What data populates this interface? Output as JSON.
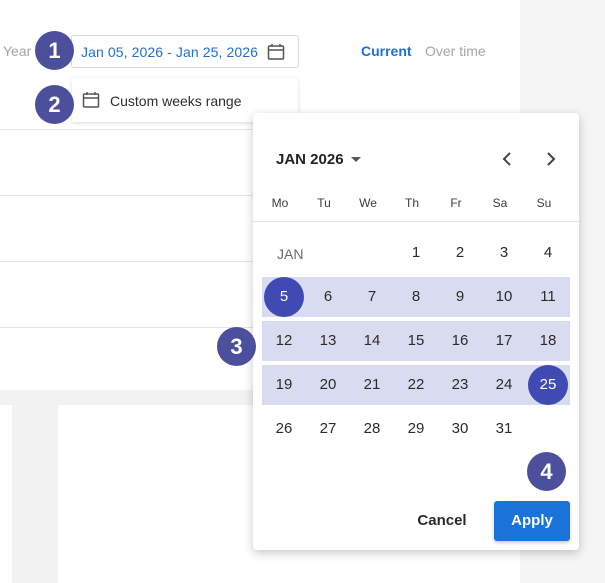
{
  "header": {
    "year_label": "Year",
    "date_range_value": "Jan 05, 2026 - Jan 25, 2026",
    "tabs": [
      {
        "label": "Current",
        "active": true
      },
      {
        "label": "Over time",
        "active": false
      }
    ]
  },
  "dropdown": {
    "custom_weeks_label": "Custom weeks range",
    "icon": "calendar-icon"
  },
  "markers": [
    "1",
    "2",
    "3",
    "4"
  ],
  "calendar": {
    "month_title": "JAN 2026",
    "month_label": "JAN",
    "weekdays": [
      "Mo",
      "Tu",
      "We",
      "Th",
      "Fr",
      "Sa",
      "Su"
    ],
    "weeks": [
      [
        "",
        "",
        "",
        "1",
        "2",
        "3",
        "4"
      ],
      [
        "5",
        "6",
        "7",
        "8",
        "9",
        "10",
        "11"
      ],
      [
        "12",
        "13",
        "14",
        "15",
        "16",
        "17",
        "18"
      ],
      [
        "19",
        "20",
        "21",
        "22",
        "23",
        "24",
        "25"
      ],
      [
        "26",
        "27",
        "28",
        "29",
        "30",
        "31",
        ""
      ]
    ],
    "range_start": "5",
    "range_end": "25",
    "cancel_label": "Cancel",
    "apply_label": "Apply"
  },
  "colors": {
    "accent": "#1a73d9",
    "selection": "#3f4ab3",
    "range_fill": "#d9dcf0",
    "marker": "#4b4f9c"
  }
}
